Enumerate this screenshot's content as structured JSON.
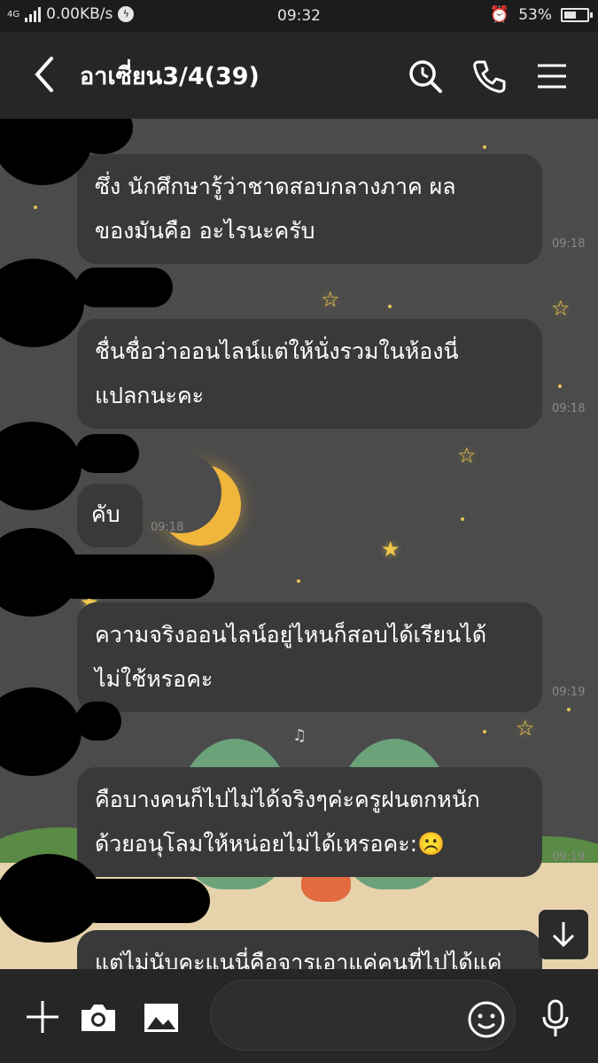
{
  "status_bar": {
    "network": "4G",
    "speed": "0.00KB/s",
    "time": "09:32",
    "battery": "53%",
    "battery_level": 0.53
  },
  "header": {
    "title": "อาเซี่ยน3/4(39)",
    "back_icon": "chevron-left-icon",
    "search_icon": "search-icon",
    "call_icon": "phone-icon",
    "menu_icon": "menu-icon"
  },
  "messages": [
    {
      "text": "ซึ่ง นักศึกษารู้ว่าชาดสอบกลางภาค ผล\nของมันคือ  อะไรนะครับ",
      "time": "09:18"
    },
    {
      "text": "ชื่นชื่อว่าออนไลน์แต่ให้นั่งรวมในห้องนี่\nแปลกนะคะ",
      "time": "09:18"
    },
    {
      "text": "คับ",
      "time": "09:18"
    },
    {
      "text": "ความจริงออนไลน์อยู่ไหนก็สอบได้เรียนได้\nไม่ใช้หรอคะ",
      "time": "09:19"
    },
    {
      "text": "คือบางคนก็ไปไม่ได้จริงๆค่ะครูฝนตกหนัก\nด้วยอนุโลมให้หน่อยไม่ได้เหรอคะ:☹️",
      "time": "09:19"
    },
    {
      "text": "แต่ไม่นับคะแนนี่คือจารเอาแค่คนที่ไปได้แค่"
    }
  ],
  "input_bar": {
    "add_icon": "plus-icon",
    "camera_icon": "camera-icon",
    "gallery_icon": "image-icon",
    "placeholder": "",
    "emoji_icon": "emoji-icon",
    "mic_icon": "microphone-icon"
  },
  "colors": {
    "header_bg": "#262626",
    "bubble_bg": "#393939",
    "chat_bg": "#4b4b4b",
    "star": "#f2c84b"
  }
}
